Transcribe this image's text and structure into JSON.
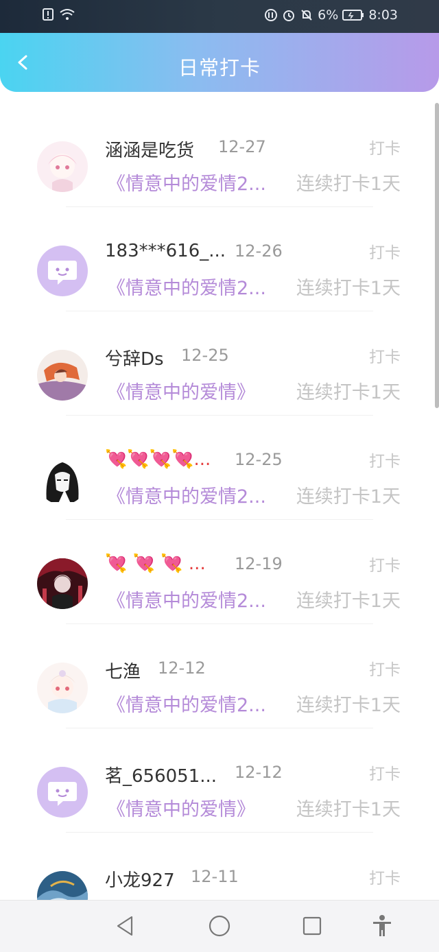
{
  "status_bar": {
    "battery": "6%",
    "time": "8:03"
  },
  "header": {
    "title": "日常打卡"
  },
  "items": [
    {
      "name": "涵涵是吃货",
      "date": "12-27",
      "tag": "打卡",
      "book": "《情意中的爱情2...",
      "streak": "连续打卡1天",
      "avatar": "anime-pink"
    },
    {
      "name": "183***616_...",
      "date": "12-26",
      "tag": "打卡",
      "book": "《情意中的爱情2...",
      "streak": "连续打卡1天",
      "avatar": "default-chat"
    },
    {
      "name": "兮辞Ds",
      "date": "12-25",
      "tag": "打卡",
      "book": "《情意中的爱情》",
      "streak": "连续打卡1天",
      "avatar": "anime-orange"
    },
    {
      "name": "💘💘💘💘...",
      "date": "12-25",
      "tag": "打卡",
      "book": "《情意中的爱情2...",
      "streak": "连续打卡1天",
      "avatar": "anime-bw"
    },
    {
      "name": "💘 💘 💘 ...",
      "date": "12-19",
      "tag": "打卡",
      "book": "《情意中的爱情2...",
      "streak": "连续打卡1天",
      "avatar": "anime-red"
    },
    {
      "name": "七渔",
      "date": "12-12",
      "tag": "打卡",
      "book": "《情意中的爱情2...",
      "streak": "连续打卡1天",
      "avatar": "anime-light"
    },
    {
      "name": "茗_656051...",
      "date": "12-12",
      "tag": "打卡",
      "book": "《情意中的爱情》",
      "streak": "连续打卡1天",
      "avatar": "default-chat"
    },
    {
      "name": "小龙927",
      "date": "12-11",
      "tag": "打卡",
      "book": "",
      "streak": "",
      "avatar": "dragon-blue"
    }
  ],
  "colors": {
    "accent_purple": "#b48ad8",
    "header_start": "#4ad4f1",
    "header_end": "#b79ae9"
  }
}
